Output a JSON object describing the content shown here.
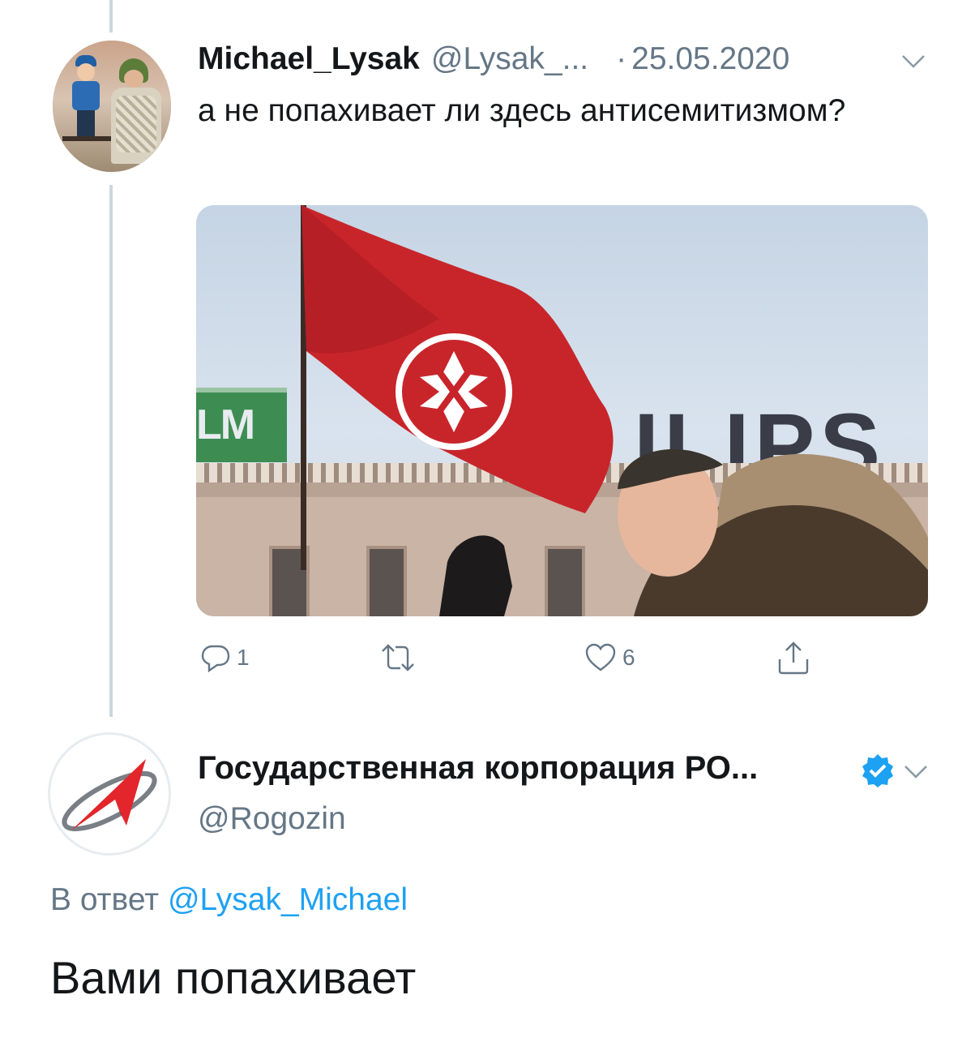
{
  "tweet1": {
    "display_name": "Michael_Lysak",
    "handle": "@Lysak_...",
    "separator": "·",
    "date": "25.05.2020",
    "text": "а не попахивает ли здесь антисемитизмом?",
    "photo": {
      "sign_left": "LM",
      "sign_right": "ILIPS"
    },
    "actions": {
      "reply_icon": "reply-icon",
      "reply_count": "1",
      "retweet_icon": "retweet-icon",
      "like_icon": "heart-icon",
      "like_count": "6",
      "share_icon": "share-icon"
    }
  },
  "tweet2": {
    "display_name": "Государственная корпорация РО...",
    "verified_icon": "verified-badge-icon",
    "handle": "@Rogozin",
    "reply_prefix": "В ответ",
    "reply_mention": "@Lysak_Michael",
    "text": "Вами попахивает"
  },
  "colors": {
    "link": "#1da1f2",
    "secondary_text": "#657786",
    "thread_line": "#ccd6dd"
  }
}
